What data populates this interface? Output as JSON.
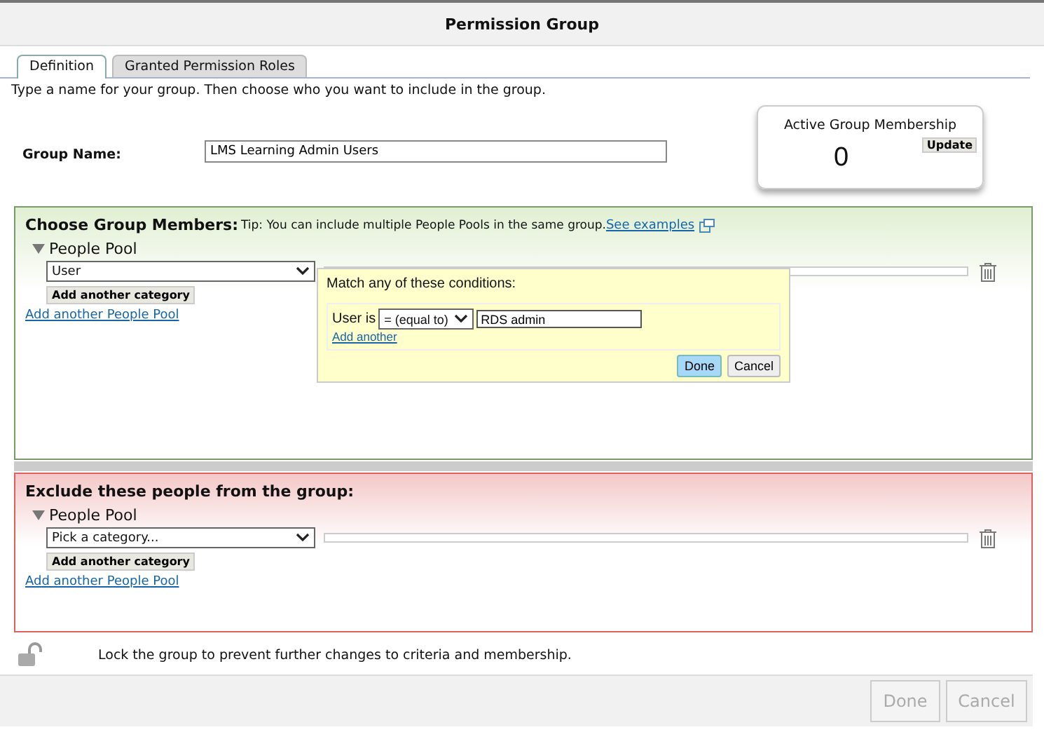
{
  "window": {
    "title": "Permission Group"
  },
  "tabs": [
    {
      "label": "Definition",
      "selected": true
    },
    {
      "label": "Granted Permission Roles",
      "selected": false
    }
  ],
  "instructions": "Type a name for your group. Then choose who you want to include in the group.",
  "group_name": {
    "label": "Group Name:",
    "value": "LMS Learning Admin Users"
  },
  "membership": {
    "title": "Active Group Membership",
    "count": "0",
    "update_button": "Update"
  },
  "include": {
    "heading": "Choose Group Members:",
    "tip": "Tip: You can include multiple People Pools in the same group.",
    "tip_link": "See examples",
    "pools": [
      {
        "title": "People Pool",
        "expanded": true,
        "category": "User",
        "add_category": "Add another category"
      }
    ],
    "add_pool": "Add another People Pool",
    "popup": {
      "title": "Match any of these conditions:",
      "field": "User is",
      "operator": "= (equal to)",
      "value": "RDS admin",
      "add_link": "Add another",
      "buttons": [
        {
          "label": "Done",
          "kind": "primary"
        },
        {
          "label": "Cancel",
          "kind": "secondary"
        }
      ]
    }
  },
  "exclude": {
    "heading": "Exclude these people from the group:",
    "pools": [
      {
        "title": "People Pool",
        "expanded": true,
        "category": "Pick a category...",
        "add_category": "Add another category"
      }
    ],
    "add_pool": "Add another People Pool"
  },
  "lock": {
    "text": "Lock the group to prevent further changes to criteria and membership.",
    "locked": false
  },
  "footer": {
    "buttons": [
      {
        "label": "Done",
        "disabled": true
      },
      {
        "label": "Cancel",
        "disabled": true
      }
    ]
  }
}
